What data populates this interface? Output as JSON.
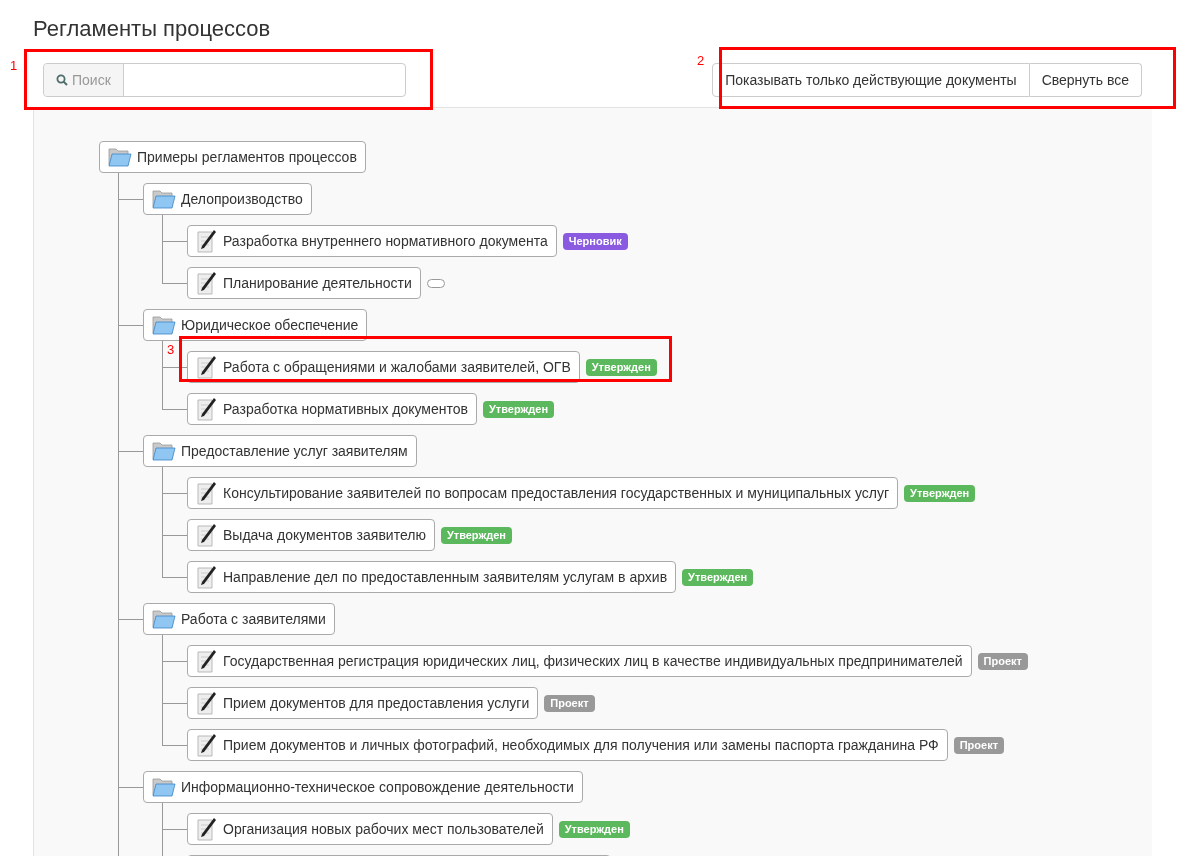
{
  "page_title": "Регламенты процессов",
  "search": {
    "label": "Поиск"
  },
  "buttons": [
    "Показывать только действующие документы",
    "Свернуть все"
  ],
  "tree": [
    {
      "kind": "folder",
      "label": "Примеры регламентов процессов",
      "children": [
        {
          "kind": "folder",
          "label": "Делопроизводство",
          "children": [
            {
              "kind": "document",
              "label": "Разработка внутреннего нормативного документа",
              "status": {
                "text": "Черновик",
                "color": "#8a5be0"
              }
            },
            {
              "kind": "document",
              "label": "Планирование деятельности",
              "status": {
                "kind": "blank"
              }
            }
          ]
        },
        {
          "kind": "folder",
          "label": "Юридическое обеспечение",
          "children": [
            {
              "kind": "document",
              "label": "Работа с обращениями и жалобами заявителей, ОГВ",
              "status": {
                "text": "Утвержден",
                "color": "#5cb85c"
              }
            },
            {
              "kind": "document",
              "label": "Разработка нормативных документов",
              "status": {
                "text": "Утвержден",
                "color": "#5cb85c"
              }
            }
          ]
        },
        {
          "kind": "folder",
          "label": "Предоставление услуг заявителям",
          "children": [
            {
              "kind": "document",
              "label": "Консультирование заявителей по вопросам предоставления государственных и муниципальных услуг",
              "status": {
                "text": "Утвержден",
                "color": "#5cb85c"
              }
            },
            {
              "kind": "document",
              "label": "Выдача документов заявителю",
              "status": {
                "text": "Утвержден",
                "color": "#5cb85c"
              }
            },
            {
              "kind": "document",
              "label": "Направление дел по предоставленным заявителям услугам в архив",
              "status": {
                "text": "Утвержден",
                "color": "#5cb85c"
              }
            }
          ]
        },
        {
          "kind": "folder",
          "label": "Работа с заявителями",
          "children": [
            {
              "kind": "document",
              "label": "Государственная регистрация юридических лиц, физических лиц в качестве индивидуальных предпринимателей",
              "status": {
                "text": "Проект",
                "color": "#999999"
              }
            },
            {
              "kind": "document",
              "label": "Прием документов для предоставления услуги",
              "status": {
                "text": "Проект",
                "color": "#999999"
              }
            },
            {
              "kind": "document",
              "label": "Прием документов и личных фотографий, необходимых для получения или замены паспорта гражданина РФ",
              "status": {
                "text": "Проект",
                "color": "#999999"
              }
            }
          ]
        },
        {
          "kind": "folder",
          "label": "Информационно-техническое сопровождение деятельности",
          "children": [
            {
              "kind": "document",
              "label": "Организация новых рабочих мест пользователей",
              "status": {
                "text": "Утвержден",
                "color": "#5cb85c"
              }
            },
            {
              "kind": "cut_off"
            }
          ]
        }
      ]
    }
  ],
  "annotations": [
    {
      "number": "1"
    },
    {
      "number": "2"
    },
    {
      "number": "3"
    }
  ]
}
